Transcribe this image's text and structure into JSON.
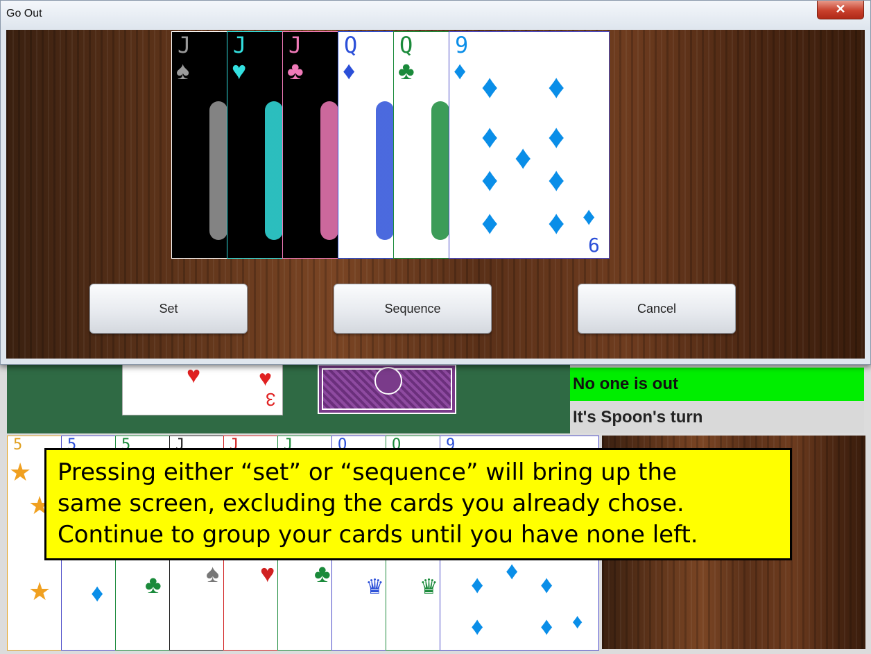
{
  "dialog": {
    "title": "Go Out",
    "close_glyph": "✕",
    "cards": [
      {
        "rank": "J",
        "suit": "♠",
        "color": "#9a9a9a",
        "bg": "#000000",
        "border": "#ffffff"
      },
      {
        "rank": "J",
        "suit": "♥",
        "color": "#33e0e0",
        "bg": "#000000",
        "border": "#33e0e0"
      },
      {
        "rank": "J",
        "suit": "♣",
        "color": "#f07ab8",
        "bg": "#000000",
        "border": "#f07ab8"
      },
      {
        "rank": "Q",
        "suit": "♦",
        "color": "#2b4fd8",
        "bg": "#ffffff",
        "border": "#2b4fd8"
      },
      {
        "rank": "Q",
        "suit": "♣",
        "color": "#1a8a3a",
        "bg": "#ffffff",
        "border": "#1a8a3a"
      },
      {
        "rank": "9",
        "suit": "♦",
        "color": "#0a8ee8",
        "bg": "#ffffff",
        "border": "#4a4ac8",
        "bottom_rank": "6"
      }
    ],
    "buttons": {
      "set": "Set",
      "sequence": "Sequence",
      "cancel": "Cancel"
    }
  },
  "game": {
    "status_out": "No one is out",
    "status_turn": "It's Spoon's turn",
    "discard": {
      "rank": "3",
      "suit": "♥"
    },
    "hand_ranks": [
      "5",
      "5",
      "5",
      "J",
      "J",
      "J",
      "Q",
      "Q",
      "9"
    ]
  },
  "callout": {
    "lines": [
      "Pressing either “set” or “sequence” will bring up the",
      "same screen, excluding the cards you already chose.",
      "Continue to group your cards until you have none left."
    ]
  },
  "colors": {
    "felt": "#2f6a44",
    "status_green": "#00ee00",
    "callout_bg": "#ffff00"
  }
}
